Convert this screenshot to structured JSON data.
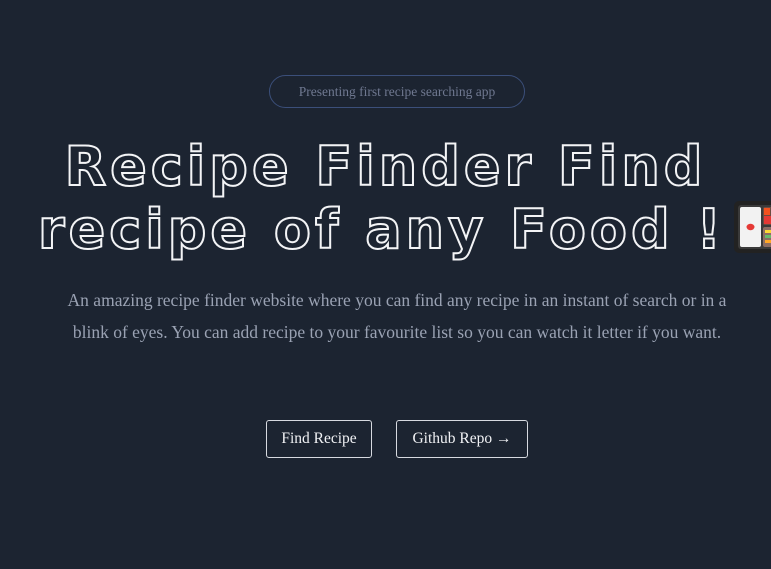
{
  "hero": {
    "badge": "Presenting first recipe searching app",
    "headline_line1": "Recipe Finder Find",
    "headline_line2": "recipe of any Food !",
    "headline_emoji_icon": "bento-box-icon",
    "description": "An amazing recipe finder website where you can find any recipe in an instant of search or in a blink of eyes. You can add recipe to your favourite list so you can watch it letter if you want."
  },
  "actions": {
    "find_recipe_label": "Find Recipe",
    "github_repo_label": "Github Repo →"
  },
  "colors": {
    "background": "#1c2431",
    "badge_border": "#3b4f7a",
    "headline_stroke": "#f3f4f6",
    "body_text": "#9aa2b3"
  }
}
